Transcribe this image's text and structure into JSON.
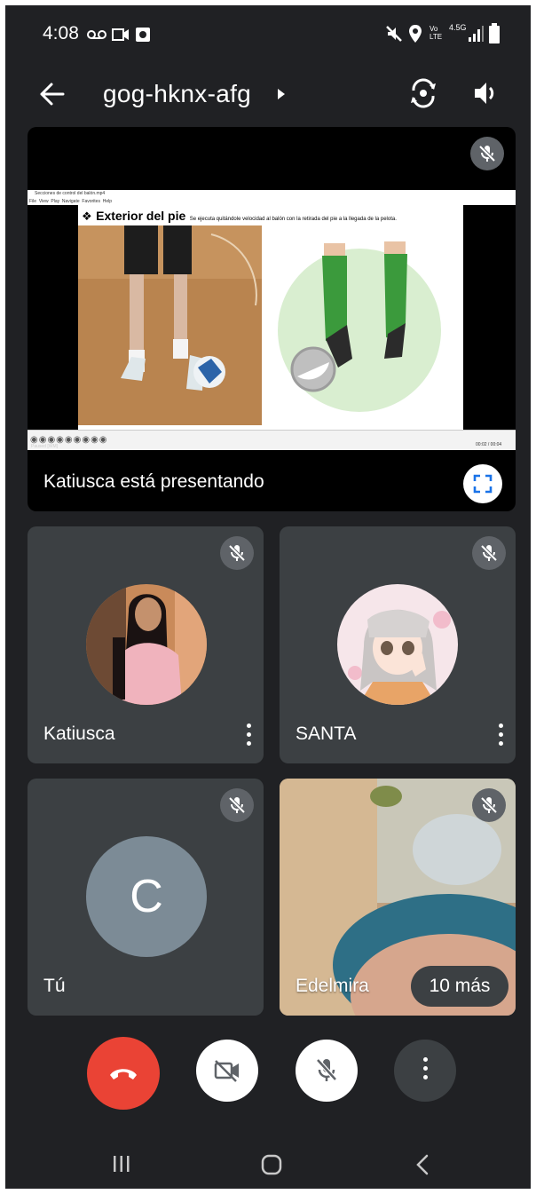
{
  "status_bar": {
    "time": "4:08",
    "left_icons": [
      "voicemail-icon",
      "video-icon",
      "app-icon"
    ],
    "right_icons": [
      "mute-icon",
      "location-icon",
      "volte-icon",
      "network-icon",
      "signal-icon",
      "battery-icon"
    ],
    "volte_text": "Vo LTE",
    "network_text": "4.5G"
  },
  "app_bar": {
    "meeting_code": "gog-hknx-afg",
    "icons": [
      "back-arrow-icon",
      "dropdown-arrow-icon",
      "switch-camera-icon",
      "speaker-icon"
    ]
  },
  "presentation": {
    "label": "Katiusca está presentando",
    "slide": {
      "window_title": "Secciones de control del balón.mp4",
      "menu": [
        "File",
        "View",
        "Play",
        "Navigate",
        "Favorites",
        "Help"
      ],
      "heading": "Exterior del pie",
      "subtitle": "Se ejecuta quitándole velocidad al balón con la retirada del pie a la llegada de la pelota.",
      "player_status": "Paused [WM]",
      "player_time": "00:02 / 00:04"
    }
  },
  "participants": [
    {
      "name": "Katiusca",
      "muted": true,
      "has_menu": true
    },
    {
      "name": "SANTA",
      "muted": true,
      "has_menu": true
    },
    {
      "name": "Tú",
      "initial": "C",
      "muted": true,
      "has_menu": false
    },
    {
      "name": "Edelmira",
      "muted": true,
      "has_menu": false
    }
  ],
  "more_participants": "10 más",
  "controls": [
    "end-call-button",
    "camera-off-button",
    "mic-off-button",
    "more-options-button"
  ],
  "colors": {
    "background": "#202124",
    "tile": "#3c4043",
    "end_call": "#ea4335",
    "avatar_c": "#7c8b96",
    "fullscreen_icon": "#1a73e8"
  },
  "nav_bar": [
    "recent-apps-icon",
    "home-icon",
    "back-icon"
  ]
}
